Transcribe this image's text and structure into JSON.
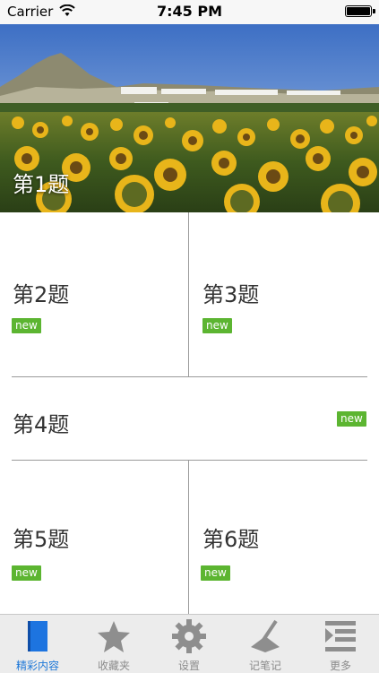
{
  "status_bar": {
    "carrier": "Carrier",
    "time": "7:45 PM"
  },
  "hero": {
    "title": "第1题"
  },
  "items": [
    {
      "title": "第2题",
      "badge": "new"
    },
    {
      "title": "第3题",
      "badge": "new"
    },
    {
      "title": "第4题",
      "badge": "new"
    },
    {
      "title": "第5题",
      "badge": "new"
    },
    {
      "title": "第6题",
      "badge": "new"
    }
  ],
  "tabs": [
    {
      "label": "精彩内容",
      "icon": "book-icon",
      "active": true
    },
    {
      "label": "收藏夹",
      "icon": "star-icon"
    },
    {
      "label": "设置",
      "icon": "gear-icon"
    },
    {
      "label": "记笔记",
      "icon": "pen-note-icon"
    },
    {
      "label": "更多",
      "icon": "more-list-icon"
    }
  ],
  "colors": {
    "badge": "#5cb531",
    "active_tab": "#1e78d8",
    "inactive_tab": "#8c8c8c"
  }
}
